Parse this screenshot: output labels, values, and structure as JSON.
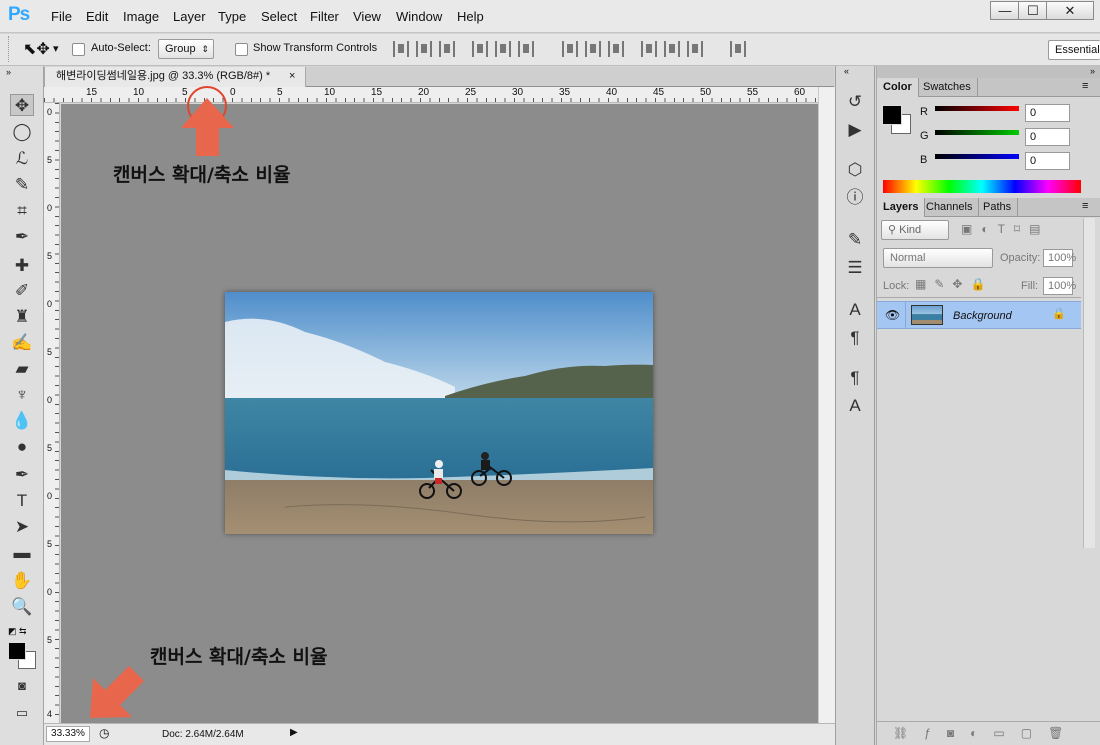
{
  "app": {
    "logo": "Ps"
  },
  "menu": [
    "File",
    "Edit",
    "Image",
    "Layer",
    "Type",
    "Select",
    "Filter",
    "View",
    "Window",
    "Help"
  ],
  "window_controls": [
    "—",
    "☐",
    "✕"
  ],
  "options": {
    "auto_select_label": "Auto-Select:",
    "auto_select_value": "Group",
    "transform_label": "Show Transform Controls",
    "workspace": "Essential"
  },
  "document": {
    "tab_title": "해변라이딩썸네일용.jpg @ ",
    "zoom_tab": "33.3%",
    "mode": "(RGB/8#) *",
    "close": "×"
  },
  "ruler": {
    "top": [
      "15",
      "10",
      "5",
      "0",
      "5",
      "10",
      "15",
      "20",
      "25",
      "30",
      "35",
      "40",
      "45",
      "50",
      "55",
      "60"
    ],
    "left": [
      "0",
      "5",
      "0",
      "5",
      "0",
      "5",
      "0",
      "5",
      "0",
      "5",
      "0",
      "5",
      "4"
    ]
  },
  "status": {
    "zoom": "33.33%",
    "doc": "Doc: 2.64M/2.64M"
  },
  "annotations": {
    "top": "캔버스 확대/축소 비율",
    "bottom": "캔버스 확대/축소 비율",
    "accent": "#e8664b"
  },
  "color_panel": {
    "tab1": "Color",
    "tab2": "Swatches",
    "r_label": "R",
    "g_label": "G",
    "b_label": "B",
    "r": "0",
    "g": "0",
    "b": "0"
  },
  "layers_panel": {
    "tab1": "Layers",
    "tab2": "Channels",
    "tab3": "Paths",
    "kind": "Kind",
    "blend": "Normal",
    "opacity_label": "Opacity:",
    "opacity": "100%",
    "lock_label": "Lock:",
    "fill_label": "Fill:",
    "fill": "100%",
    "layer_name": "Background"
  },
  "icons": {
    "move": "move-tool-icon",
    "marquee": "marquee-icon",
    "lasso": "lasso-icon"
  }
}
